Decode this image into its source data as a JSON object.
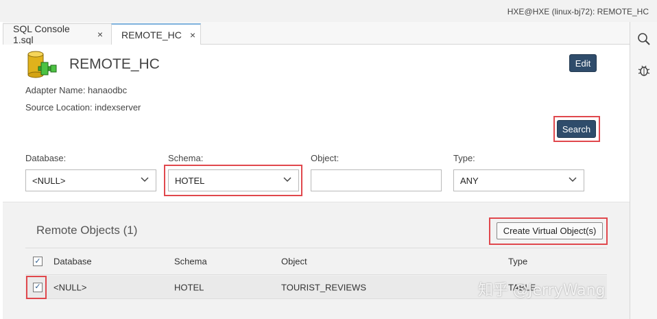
{
  "header": {
    "user_info": "HXE@HXE (linux-bj72): REMOTE_HC"
  },
  "tabs": [
    {
      "label": "SQL Console 1.sql",
      "close": "×"
    },
    {
      "label": "REMOTE_HC",
      "close": "×"
    }
  ],
  "source": {
    "title": "REMOTE_HC",
    "adapter": "Adapter Name: hanaodbc",
    "location": "Source Location: indexserver",
    "edit_label": "Edit",
    "search_label": "Search"
  },
  "filters": {
    "database": {
      "label": "Database:",
      "value": "<NULL>"
    },
    "schema": {
      "label": "Schema:",
      "value": "HOTEL"
    },
    "object": {
      "label": "Object:",
      "value": ""
    },
    "type": {
      "label": "Type:",
      "value": "ANY"
    }
  },
  "remote_objects": {
    "title": "Remote Objects (1)",
    "create_label": "Create Virtual Object(s)",
    "columns": [
      "Database",
      "Schema",
      "Object",
      "Type"
    ],
    "rows": [
      {
        "database": "<NULL>",
        "schema": "HOTEL",
        "object": "TOURIST_REVIEWS",
        "type": "TABLE"
      }
    ]
  },
  "watermark": "知乎 @JerryWang",
  "colors": {
    "accent_dark": "#2f4c6b",
    "highlight": "#e0474c",
    "tab_active_border": "#7fb2dd"
  }
}
